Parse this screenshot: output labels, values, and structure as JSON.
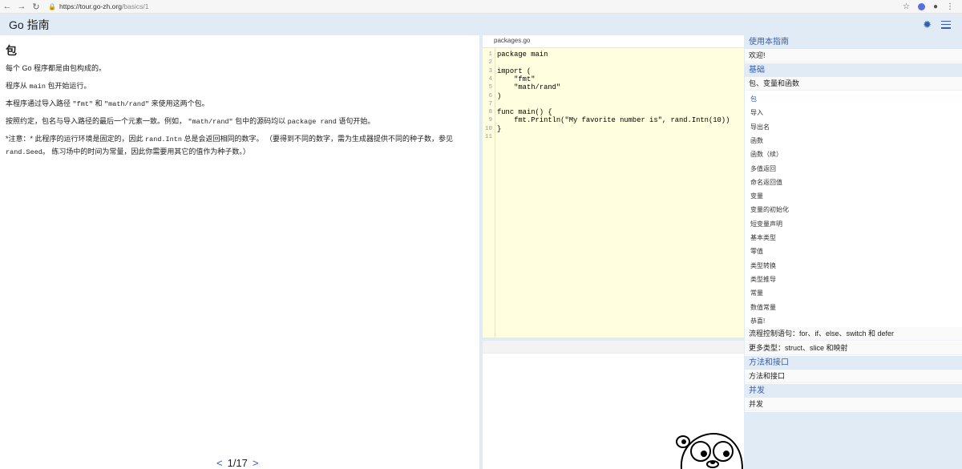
{
  "browser": {
    "back": "←",
    "forward": "→",
    "reload": "↻",
    "url_host": "https://tour.go-zh.org",
    "url_path": "/basics/1",
    "star": "☆",
    "account": "●",
    "menu": "⋮"
  },
  "header": {
    "brand": "Go 指南",
    "gear": "✹"
  },
  "article": {
    "title": "包",
    "p1": "每个 Go 程序都是由包构成的。",
    "p2_a": "程序从 ",
    "p2_code": "main",
    "p2_b": " 包开始运行。",
    "p3_a": "本程序通过导入路径 ",
    "p3_c1": "\"fmt\"",
    "p3_b": " 和 ",
    "p3_c2": "\"math/rand\"",
    "p3_c": " 来使用这两个包。",
    "p4_a": "按照约定，包名与导入路径的最后一个元素一致。例如， ",
    "p4_c1": "\"math/rand\"",
    "p4_b": " 包中的源码均以 ",
    "p4_c2": "package rand",
    "p4_c": " 语句开始。",
    "p5_a": "*注意：* 此程序的运行环境是固定的，因此 ",
    "p5_c1": "rand.Intn",
    "p5_b": " 总是会返回相同的数字。 （要得到不同的数字，需为生成器提供不同的种子数，参见 ",
    "p5_c2": "rand.Seed",
    "p5_c": "。 练习场中的时间为常量，因此你需要用其它的值作为种子数。）",
    "pager_prev": "<",
    "pager_text": "1/17",
    "pager_next": ">"
  },
  "editor": {
    "filename": "packages.go",
    "line_numbers": [
      "1",
      "2",
      "3",
      "4",
      "5",
      "6",
      "7",
      "8",
      "9",
      "10",
      "11"
    ],
    "lines": [
      "package main",
      "",
      "import (",
      "\t\"fmt\"",
      "\t\"math/rand\"",
      ")",
      "",
      "func main() {",
      "\tfmt.Println(\"My favorite number is\", rand.Intn(10))",
      "}",
      ""
    ]
  },
  "toc": {
    "sections": [
      {
        "lesson": "使用本指南",
        "module": "欢迎!"
      },
      {
        "lesson": "基础",
        "module": "包、变量和函数"
      }
    ],
    "pages": [
      "包",
      "导入",
      "导出名",
      "函数",
      "函数（续）",
      "多值返回",
      "命名返回值",
      "变量",
      "变量的初始化",
      "短变量声明",
      "基本类型",
      "零值",
      "类型转换",
      "类型推导",
      "常量",
      "数值常量",
      "恭喜!"
    ],
    "more_modules": [
      "流程控制语句：for、if、else、switch 和 defer",
      "更多类型：struct、slice 和映射"
    ],
    "lesson3": "方法和接口",
    "module3": "方法和接口",
    "lesson4": "并发",
    "module4": "并发"
  },
  "colors": {
    "accent": "#375eab",
    "header_bg": "#e0ebf5",
    "editor_bg": "#ffffe0"
  }
}
